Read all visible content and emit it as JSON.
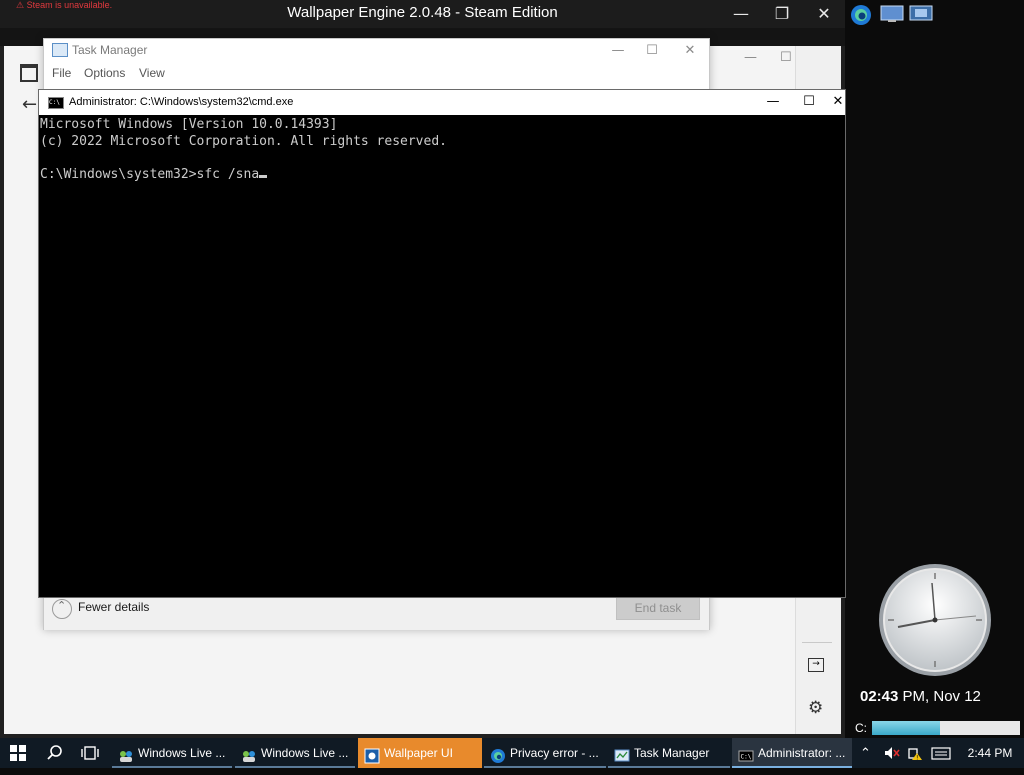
{
  "wallpaper_engine": {
    "title": "Wallpaper Engine 2.0.48 - Steam Edition",
    "steam_warning": "Steam is unavailable."
  },
  "task_manager": {
    "title": "Task Manager",
    "menu": [
      "File",
      "Options",
      "View"
    ],
    "fewer_details": "Fewer details",
    "end_task": "End task"
  },
  "cmd": {
    "title": "Administrator: C:\\Windows\\system32\\cmd.exe",
    "lines": [
      "Microsoft Windows [Version 10.0.14393]",
      "(c) 2022 Microsoft Corporation. All rights reserved.",
      "",
      "C:\\Windows\\system32>sfc /sna"
    ]
  },
  "gadgets": {
    "time": "02:43",
    "time_suffix": " PM, Nov 12",
    "drive_label": "C:",
    "drive_used_fraction": 0.46
  },
  "taskbar": {
    "items": [
      "Windows Live ...",
      "Windows Live ...",
      "Wallpaper UI",
      "Privacy error - ...",
      "Task Manager",
      "Administrator: ..."
    ],
    "clock": "2:44 PM"
  },
  "colors": {
    "accent_taskbar_active": "#e88a2c",
    "steam_warning": "#e0393e",
    "console_text": "#cccccc"
  }
}
